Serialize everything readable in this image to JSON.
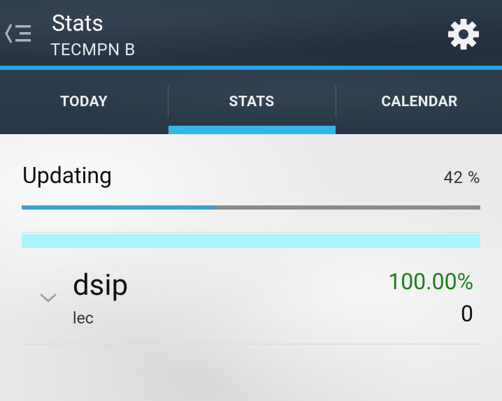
{
  "header": {
    "title": "Stats",
    "subtitle": "TECMPN B",
    "back_icon": "menu-back-icon",
    "settings_icon": "gear-icon"
  },
  "tabs": [
    {
      "label": "TODAY",
      "selected": false
    },
    {
      "label": "STATS",
      "selected": true
    },
    {
      "label": "CALENDAR",
      "selected": false
    }
  ],
  "update": {
    "label": "Updating",
    "percent_text": "42 %",
    "progress": 0.42
  },
  "subjects": [
    {
      "name": "dsip",
      "type": "lec",
      "percent": "100.00%",
      "count": "0",
      "expander_icon": "chevron-down-icon"
    }
  ],
  "colors": {
    "accent": "#1ea7e8",
    "tab_indicator": "#33b5e5",
    "band": "#a8f4fb",
    "percent_text": "#1c7d1c"
  }
}
